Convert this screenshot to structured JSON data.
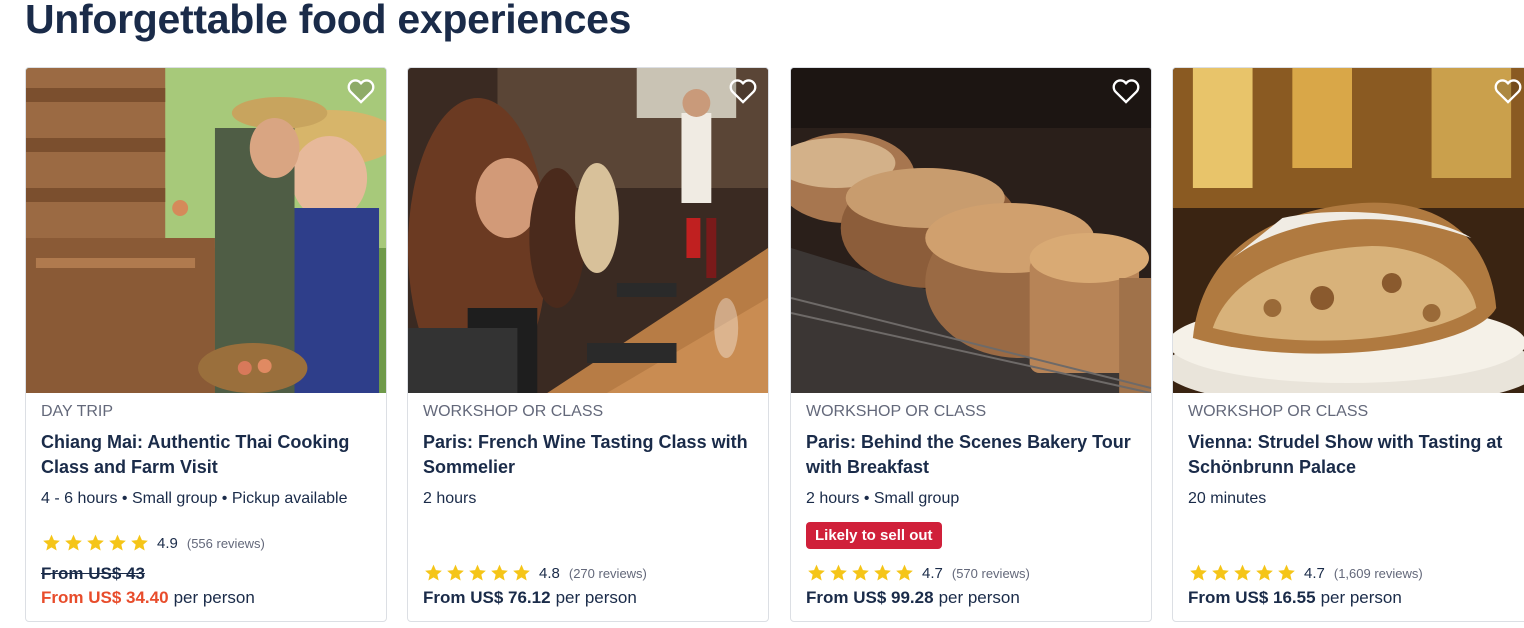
{
  "section": {
    "title": "Unforgettable food experiences"
  },
  "icons": {
    "wishlist": "heart-outline-icon",
    "rating_star": "star-icon"
  },
  "colors": {
    "star": "#f5c518",
    "sale_price": "#e84c2b",
    "badge": "#d0203a",
    "text": "#1a2b49"
  },
  "cards": [
    {
      "category": "DAY TRIP",
      "title": "Chiang Mai: Authentic Thai Cooking Class and Farm Visit",
      "meta": "4 - 6 hours • Small group • Pickup available",
      "rating": "4.9",
      "reviews": "(556 reviews)",
      "stars": 5,
      "price_original": "From US$ 43",
      "price": "From US$ 34.40",
      "per_person": "per person"
    },
    {
      "category": "WORKSHOP OR CLASS",
      "title": "Paris: French Wine Tasting Class with Sommelier",
      "meta": "2 hours",
      "rating": "4.8",
      "reviews": "(270 reviews)",
      "stars": 5,
      "price": "From US$ 76.12",
      "per_person": "per person"
    },
    {
      "category": "WORKSHOP OR CLASS",
      "title": "Paris: Behind the Scenes Bakery Tour with Breakfast",
      "meta": "2 hours • Small group",
      "badge": "Likely to sell out",
      "rating": "4.7",
      "reviews": "(570 reviews)",
      "stars": 5,
      "price": "From US$ 99.28",
      "per_person": "per person"
    },
    {
      "category": "WORKSHOP OR CLASS",
      "title": "Vienna: Strudel Show with Tasting at Schönbrunn Palace",
      "meta": "20 minutes",
      "rating": "4.7",
      "reviews": "(1,609 reviews)",
      "stars": 5,
      "price": "From US$ 16.55",
      "per_person": "per person"
    }
  ]
}
